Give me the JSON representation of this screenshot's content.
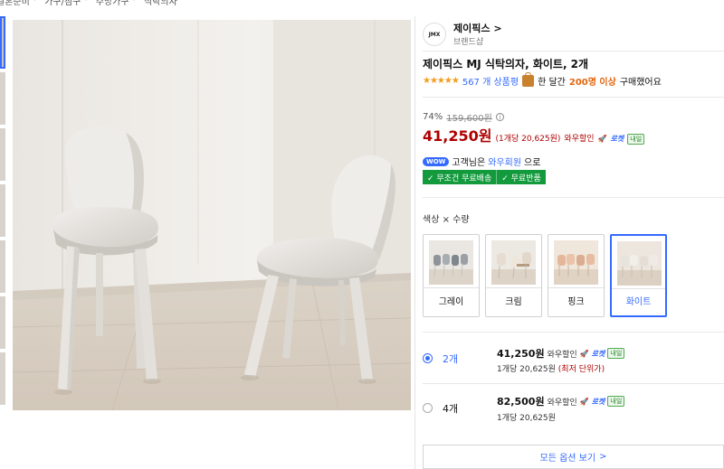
{
  "breadcrumb": [
    "결혼준비",
    "가구/침구",
    "주방가구",
    "식탁의자"
  ],
  "brand": {
    "logo_text": "JMX",
    "name": "제이픽스",
    "chevron": ">",
    "sub": "브랜드샵"
  },
  "product": {
    "title": "제이픽스 MJ 식탁의자, 화이트, 2개",
    "stars": "★★★★★",
    "review_count": "567 개 상품평",
    "buyers_prefix": "한 달간",
    "buyers_count": "200명 이상",
    "buyers_suffix": "구매했어요"
  },
  "price": {
    "discount_rate": "74%",
    "original": "159,600원",
    "info_icon": "i",
    "sale": "41,250원",
    "unit": "(1개당 20,625원)",
    "wow_sale": "와우할인",
    "rocket": "로켓",
    "naeil": "내일"
  },
  "wow": {
    "badge": "WOW",
    "text_prefix": "고객님은",
    "link": "와우회원",
    "text_suffix": "으로"
  },
  "benefits": [
    "✓ 무조건 무료배송",
    "✓ 무료반품"
  ],
  "options": {
    "title": "색상 × 수량",
    "colors": [
      {
        "label": "그레이",
        "selected": false
      },
      {
        "label": "크림",
        "selected": false
      },
      {
        "label": "핑크",
        "selected": false
      },
      {
        "label": "화이트",
        "selected": true
      }
    ]
  },
  "quantities": [
    {
      "label": "2개",
      "price": "41,250원",
      "wow": "와우할인",
      "rocket": "로켓",
      "naeil": "내일",
      "unit": "1개당 20,625원",
      "lowest": "(최저 단위가)",
      "selected": true
    },
    {
      "label": "4개",
      "price": "82,500원",
      "wow": "와우할인",
      "rocket": "로켓",
      "naeil": "내일",
      "unit": "1개당 20,625원",
      "lowest": "",
      "selected": false
    }
  ],
  "more_button": "모든 옵션 보기",
  "more_chevron": ">",
  "colors": {
    "accent": "#346aff",
    "price_red": "#ae0000",
    "benefit_green": "#129a3d",
    "star": "#f49b1c"
  }
}
